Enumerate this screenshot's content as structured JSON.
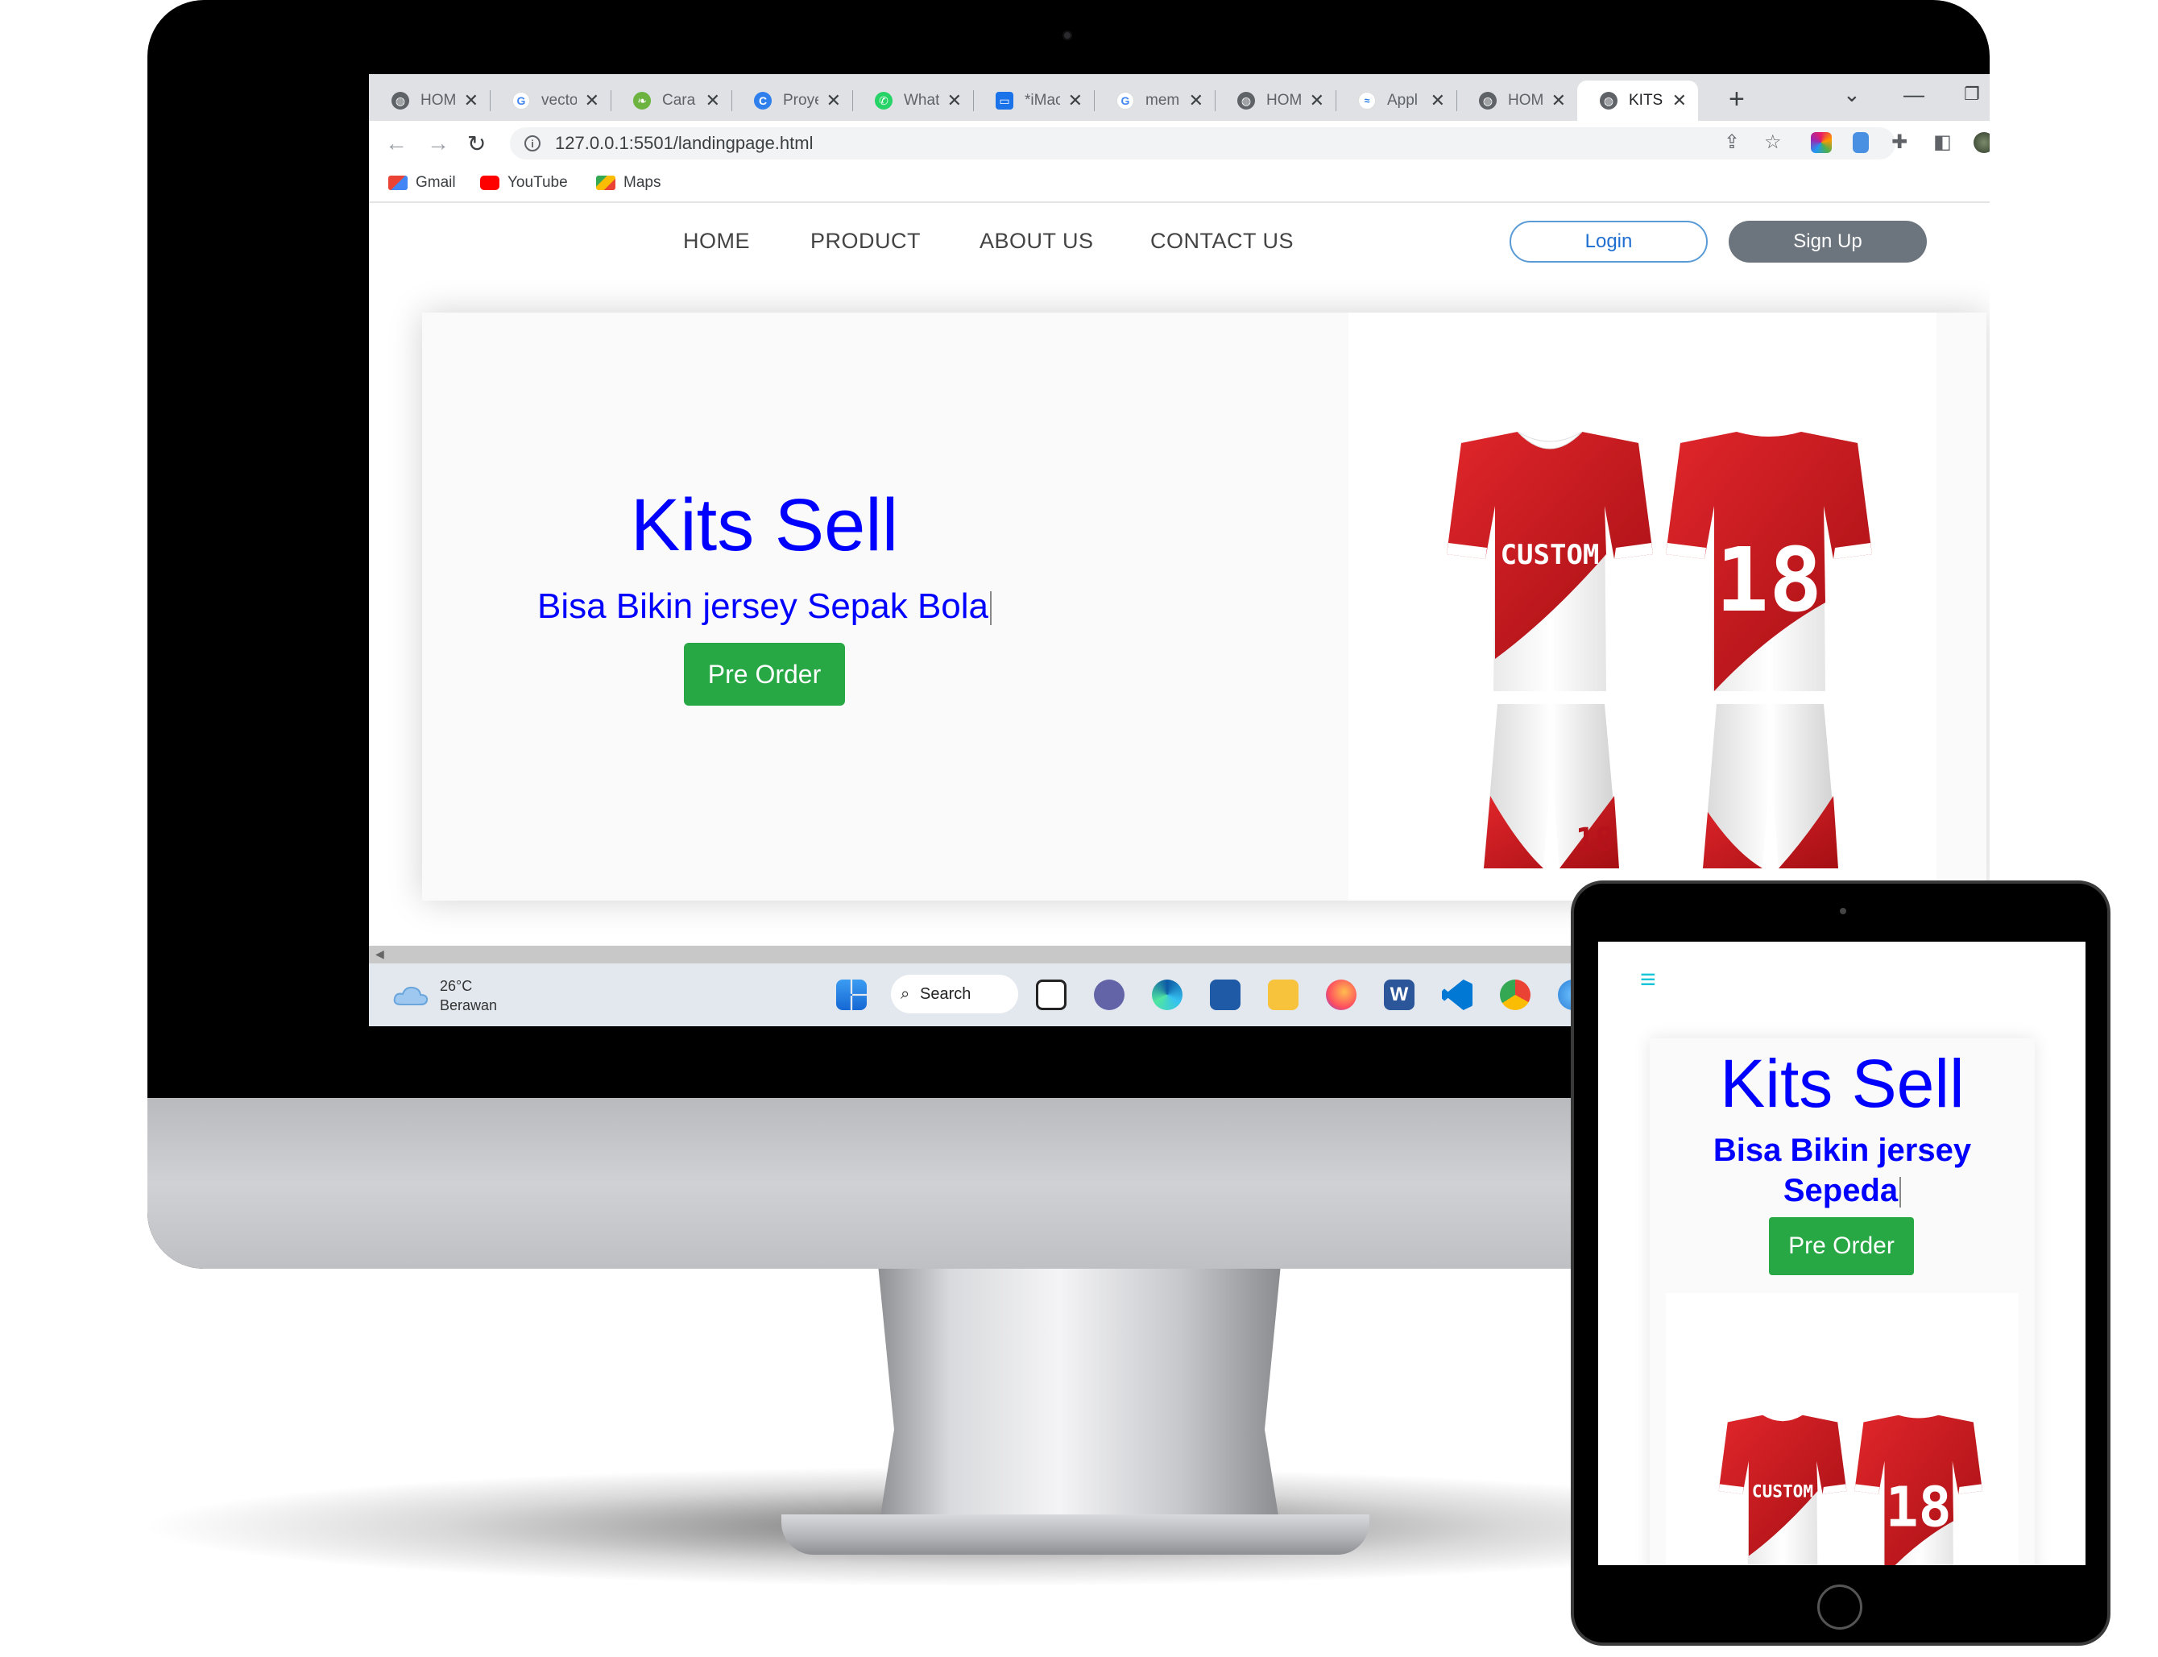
{
  "browser": {
    "tabs": [
      {
        "title": "HOM",
        "icon": "globe-icon"
      },
      {
        "title": "vecto",
        "icon": "google-icon"
      },
      {
        "title": "Cara",
        "icon": "leaf-icon"
      },
      {
        "title": "Proye",
        "icon": "c-icon"
      },
      {
        "title": "Whats",
        "icon": "whatsapp-icon"
      },
      {
        "title": "*iMac",
        "icon": "imac-icon"
      },
      {
        "title": "mem",
        "icon": "google-icon"
      },
      {
        "title": "HOM",
        "icon": "globe-icon"
      },
      {
        "title": "Appl",
        "icon": "wave-icon"
      },
      {
        "title": "HOM",
        "icon": "globe-icon"
      },
      {
        "title": "KITS",
        "icon": "globe-icon",
        "active": true
      }
    ],
    "close_glyph": "✕",
    "new_tab_glyph": "+",
    "url": "127.0.0.1:5501/landingpage.html",
    "bookmarks": [
      {
        "label": "Gmail",
        "icon": "gmail-icon"
      },
      {
        "label": "YouTube",
        "icon": "youtube-icon"
      },
      {
        "label": "Maps",
        "icon": "maps-icon"
      }
    ]
  },
  "site": {
    "nav": [
      "HOME",
      "PRODUCT",
      "ABOUT US",
      "CONTACT US"
    ],
    "login_label": "Login",
    "signup_label": "Sign Up",
    "hero_title": "Kits Sell",
    "hero_subtitle": "Bisa Bikin jersey Sepak Bola",
    "hero_button": "Pre Order",
    "jersey_front_text": "CUSTOM",
    "jersey_back_number": "18"
  },
  "taskbar": {
    "temperature": "26°C",
    "weather": "Berawan",
    "search_label": "Search"
  },
  "tablet": {
    "menu_icon": "hamburger-icon",
    "hero_title": "Kits Sell",
    "hero_subtitle_line1": "Bisa Bikin jersey",
    "hero_subtitle_line2": "Sepeda",
    "hero_button": "Pre Order",
    "jersey_front_text": "CUSTOM",
    "jersey_back_number": "18"
  },
  "colors": {
    "title_blue": "#0000ff",
    "button_green": "#28a745",
    "signup_gray": "#6c757d",
    "jersey_red": "#c4161c",
    "hamburger_cyan": "#17c4d8"
  }
}
